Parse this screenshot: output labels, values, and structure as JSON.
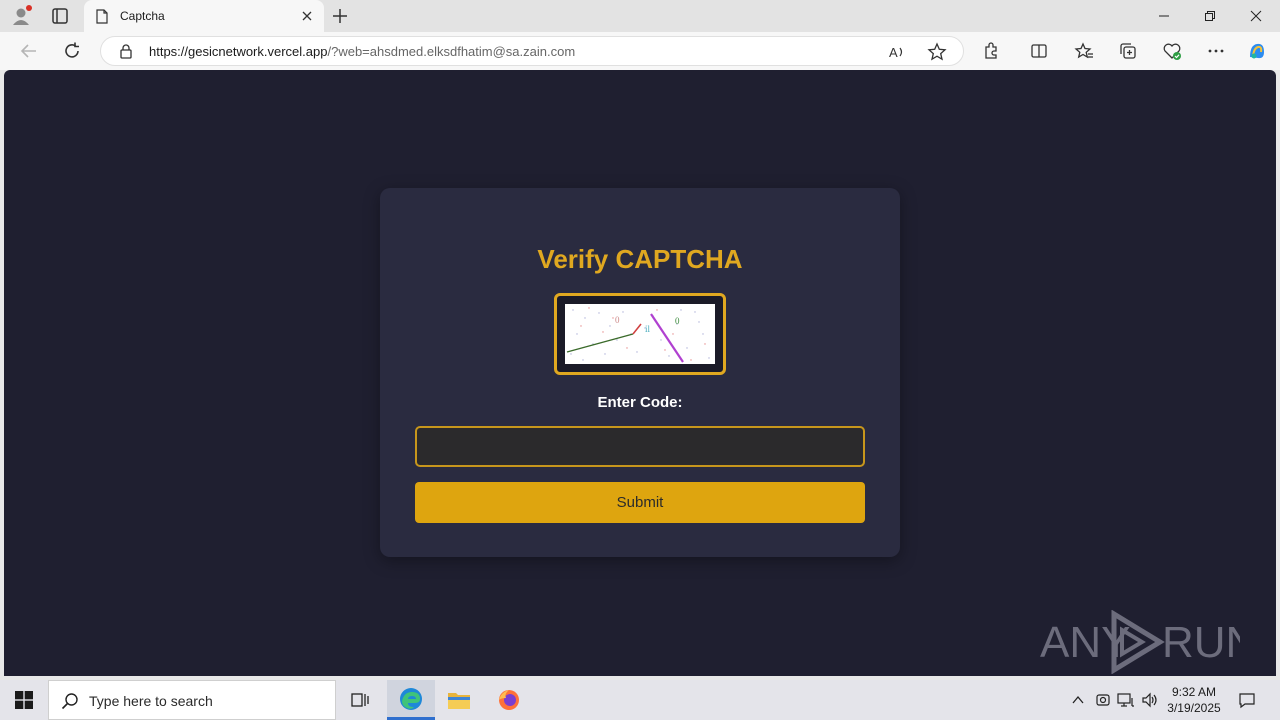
{
  "browser": {
    "tab_title": "Captcha",
    "url_host": "https://gesicnetwork.vercel.app",
    "url_path": "/?web=ahsdmed.elksdfhatim@sa.zain.com"
  },
  "page": {
    "title": "Verify CAPTCHA",
    "code_label": "Enter Code:",
    "input_value": "",
    "submit_label": "Submit"
  },
  "watermark": {
    "left": "ANY",
    "right": "RUN"
  },
  "taskbar": {
    "search_placeholder": "Type here to search",
    "time": "9:32 AM",
    "date": "3/19/2025"
  },
  "colors": {
    "accent": "#e0a820",
    "button": "#dea50f",
    "page_bg": "#1f1f30",
    "card_bg": "#2a2b40"
  },
  "icons": [
    "profile-icon",
    "tab-actions-icon",
    "page-icon",
    "close-icon",
    "plus-icon",
    "minimize-icon",
    "restore-icon",
    "back-icon",
    "refresh-icon",
    "lock-icon",
    "read-aloud-icon",
    "favorite-star-icon",
    "extensions-icon",
    "split-screen-icon",
    "favorites-icon",
    "collections-icon",
    "browser-essentials-icon",
    "more-icon",
    "copilot-icon",
    "windows-start-icon",
    "search-icon",
    "task-view-icon",
    "edge-icon",
    "file-explorer-icon",
    "firefox-icon",
    "chevron-up-icon",
    "meet-now-icon",
    "network-icon",
    "volume-icon",
    "notifications-icon"
  ]
}
